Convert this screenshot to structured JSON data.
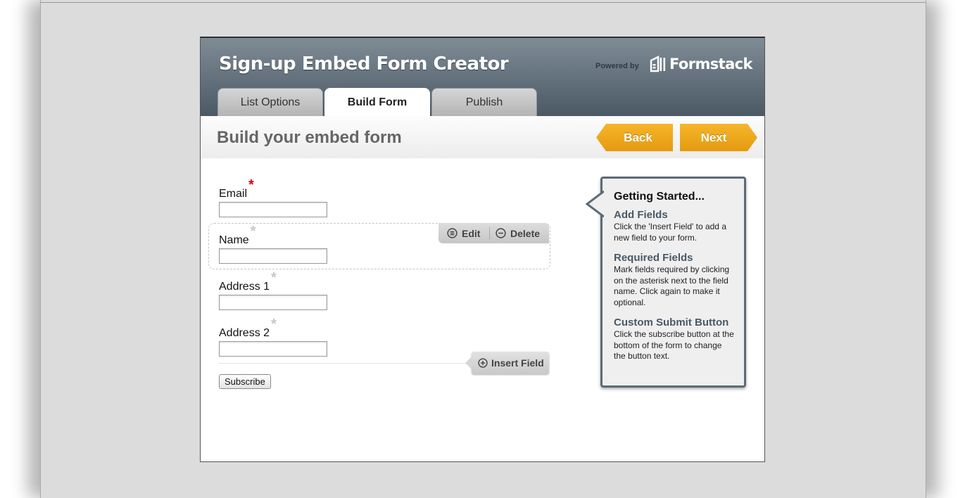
{
  "app": {
    "title": "Sign-up Embed Form Creator"
  },
  "branding": {
    "powered_by": "Powered by",
    "name": "Formstack"
  },
  "tabs": [
    {
      "label": "List Options",
      "active": false
    },
    {
      "label": "Build Form",
      "active": true
    },
    {
      "label": "Publish",
      "active": false
    }
  ],
  "page": {
    "title": "Build your embed form"
  },
  "nav": {
    "back_label": "Back",
    "next_label": "Next"
  },
  "form": {
    "fields": [
      {
        "label": "Email",
        "required": true,
        "value": ""
      },
      {
        "label": "Name",
        "required": false,
        "value": ""
      },
      {
        "label": "Address 1",
        "required": false,
        "value": ""
      },
      {
        "label": "Address 2",
        "required": false,
        "value": ""
      }
    ],
    "required_marker": "*",
    "field_actions": {
      "edit_label": "Edit",
      "delete_label": "Delete"
    },
    "insert_field_label": "Insert Field",
    "submit_label": "Subscribe"
  },
  "help": {
    "title": "Getting Started...",
    "sections": [
      {
        "heading": "Add Fields",
        "body": "Click the 'Insert Field' to add a new field to your form."
      },
      {
        "heading": "Required Fields",
        "body": "Mark fields required by clicking on the asterisk next to the field name. Click again to make it optional."
      },
      {
        "heading": "Custom Submit Button",
        "body": "Click the subscribe button at the bottom of the form to change the button text."
      }
    ]
  },
  "colors": {
    "header_bg": "#5a6874",
    "accent_orange": "#f0a81f",
    "required_red": "#d40000",
    "help_border": "#5d6b77"
  }
}
